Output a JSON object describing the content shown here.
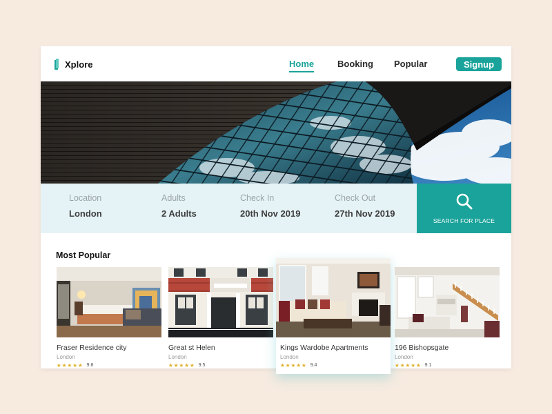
{
  "brand": {
    "name": "Xplore",
    "accent": "#1aa39a"
  },
  "nav": {
    "links": [
      {
        "label": "Home",
        "active": true
      },
      {
        "label": "Booking",
        "active": false
      },
      {
        "label": "Popular",
        "active": false
      }
    ],
    "signup_label": "Signup"
  },
  "search": {
    "fields": [
      {
        "label": "Location",
        "value": "London"
      },
      {
        "label": "Adults",
        "value": "2 Adults"
      },
      {
        "label": "Check In",
        "value": "20th Nov 2019"
      },
      {
        "label": "Check Out",
        "value": "27th Nov 2019"
      }
    ],
    "button_label": "SEARCH FOR PLACE",
    "button_icon": "search-icon"
  },
  "popular": {
    "title": "Most Popular",
    "listings": [
      {
        "name": "Fraser Residence city",
        "city": "London",
        "stars": 5,
        "score": "9.8"
      },
      {
        "name": "Great st Helen",
        "city": "London",
        "stars": 5,
        "score": "9.5"
      },
      {
        "name": "Kings Wardobe Apartments",
        "city": "London",
        "stars": 5,
        "score": "9.4"
      },
      {
        "name": "196 Bishopsgate",
        "city": "London",
        "stars": 5,
        "score": "9.1"
      }
    ]
  }
}
